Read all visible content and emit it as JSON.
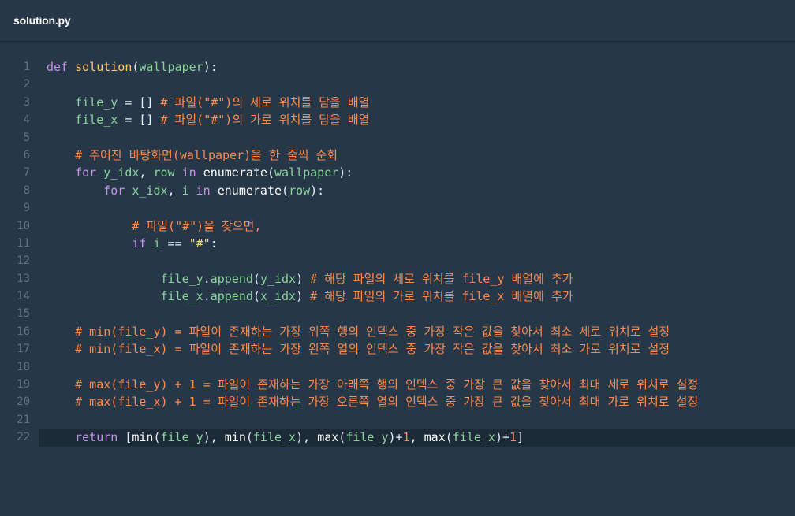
{
  "file": {
    "name": "solution.py"
  },
  "editor": {
    "active_line": 22,
    "lines": [
      {
        "n": "1",
        "tokens": [
          [
            "kw",
            "def "
          ],
          [
            "fn",
            "solution"
          ],
          [
            "pl",
            "("
          ],
          [
            "var",
            "wallpaper"
          ],
          [
            "pl",
            "):"
          ]
        ]
      },
      {
        "n": "2",
        "tokens": []
      },
      {
        "n": "3",
        "tokens": [
          [
            "pl",
            "    "
          ],
          [
            "var",
            "file_y"
          ],
          [
            "pl",
            " = [] "
          ],
          [
            "cm",
            "# 파일(\"#\")의 세로 위치를 담을 배열"
          ]
        ]
      },
      {
        "n": "4",
        "tokens": [
          [
            "pl",
            "    "
          ],
          [
            "var",
            "file_x"
          ],
          [
            "pl",
            " = [] "
          ],
          [
            "cm",
            "# 파일(\"#\")의 가로 위치를 담을 배열"
          ]
        ]
      },
      {
        "n": "5",
        "tokens": []
      },
      {
        "n": "6",
        "tokens": [
          [
            "pl",
            "    "
          ],
          [
            "cm",
            "# 주어진 바탕화면(wallpaper)을 한 줄씩 순회"
          ]
        ]
      },
      {
        "n": "7",
        "tokens": [
          [
            "pl",
            "    "
          ],
          [
            "kw",
            "for "
          ],
          [
            "var",
            "y_idx"
          ],
          [
            "pl",
            ", "
          ],
          [
            "var",
            "row "
          ],
          [
            "kw",
            "in "
          ],
          [
            "bi",
            "enumerate"
          ],
          [
            "pl",
            "("
          ],
          [
            "var",
            "wallpaper"
          ],
          [
            "pl",
            "):"
          ]
        ]
      },
      {
        "n": "8",
        "tokens": [
          [
            "pl",
            "        "
          ],
          [
            "kw",
            "for "
          ],
          [
            "var",
            "x_idx"
          ],
          [
            "pl",
            ", "
          ],
          [
            "var",
            "i "
          ],
          [
            "kw",
            "in "
          ],
          [
            "bi",
            "enumerate"
          ],
          [
            "pl",
            "("
          ],
          [
            "var",
            "row"
          ],
          [
            "pl",
            "):"
          ]
        ]
      },
      {
        "n": "9",
        "tokens": []
      },
      {
        "n": "10",
        "tokens": [
          [
            "pl",
            "            "
          ],
          [
            "cm",
            "# 파일(\"#\")을 찾으면,"
          ]
        ]
      },
      {
        "n": "11",
        "tokens": [
          [
            "pl",
            "            "
          ],
          [
            "kw",
            "if "
          ],
          [
            "var",
            "i "
          ],
          [
            "pl",
            "== "
          ],
          [
            "str",
            "\"#\""
          ],
          [
            "pl",
            ":"
          ]
        ]
      },
      {
        "n": "12",
        "tokens": []
      },
      {
        "n": "13",
        "tokens": [
          [
            "pl",
            "                "
          ],
          [
            "var",
            "file_y"
          ],
          [
            "pl",
            "."
          ],
          [
            "var",
            "append"
          ],
          [
            "pl",
            "("
          ],
          [
            "var",
            "y_idx"
          ],
          [
            "pl",
            ") "
          ],
          [
            "cm",
            "# 해당 파일의 세로 위치를 file_y 배열에 추가"
          ]
        ]
      },
      {
        "n": "14",
        "tokens": [
          [
            "pl",
            "                "
          ],
          [
            "var",
            "file_x"
          ],
          [
            "pl",
            "."
          ],
          [
            "var",
            "append"
          ],
          [
            "pl",
            "("
          ],
          [
            "var",
            "x_idx"
          ],
          [
            "pl",
            ") "
          ],
          [
            "cm",
            "# 해당 파일의 가로 위치를 file_x 배열에 추가"
          ]
        ]
      },
      {
        "n": "15",
        "tokens": []
      },
      {
        "n": "16",
        "tokens": [
          [
            "pl",
            "    "
          ],
          [
            "cm",
            "# min(file_y) = 파일이 존재하는 가장 위쪽 행의 인덱스 중 가장 작은 값을 찾아서 최소 세로 위치로 설정"
          ]
        ]
      },
      {
        "n": "17",
        "tokens": [
          [
            "pl",
            "    "
          ],
          [
            "cm",
            "# min(file_x) = 파일이 존재하는 가장 왼쪽 열의 인덱스 중 가장 작은 값을 찾아서 최소 가로 위치로 설정"
          ]
        ]
      },
      {
        "n": "18",
        "tokens": []
      },
      {
        "n": "19",
        "tokens": [
          [
            "pl",
            "    "
          ],
          [
            "cm",
            "# max(file_y) + 1 = 파일이 존재하는 가장 아래쪽 행의 인덱스 중 가장 큰 값을 찾아서 최대 세로 위치로 설정"
          ]
        ]
      },
      {
        "n": "20",
        "tokens": [
          [
            "pl",
            "    "
          ],
          [
            "cm",
            "# max(file_x) + 1 = 파일이 존재하는 가장 오른쪽 열의 인덱스 중 가장 큰 값을 찾아서 최대 가로 위치로 설정"
          ]
        ]
      },
      {
        "n": "21",
        "tokens": []
      },
      {
        "n": "22",
        "tokens": [
          [
            "pl",
            "    "
          ],
          [
            "kw",
            "return "
          ],
          [
            "pl",
            "["
          ],
          [
            "bi",
            "min"
          ],
          [
            "pl",
            "("
          ],
          [
            "var",
            "file_y"
          ],
          [
            "pl",
            "), "
          ],
          [
            "bi",
            "min"
          ],
          [
            "pl",
            "("
          ],
          [
            "var",
            "file_x"
          ],
          [
            "pl",
            "), "
          ],
          [
            "bi",
            "max"
          ],
          [
            "pl",
            "("
          ],
          [
            "var",
            "file_y"
          ],
          [
            "pl",
            ")+"
          ],
          [
            "num",
            "1"
          ],
          [
            "pl",
            ", "
          ],
          [
            "bi",
            "max"
          ],
          [
            "pl",
            "("
          ],
          [
            "var",
            "file_x"
          ],
          [
            "pl",
            ")+"
          ],
          [
            "num",
            "1"
          ],
          [
            "pl",
            "]"
          ]
        ]
      }
    ]
  }
}
